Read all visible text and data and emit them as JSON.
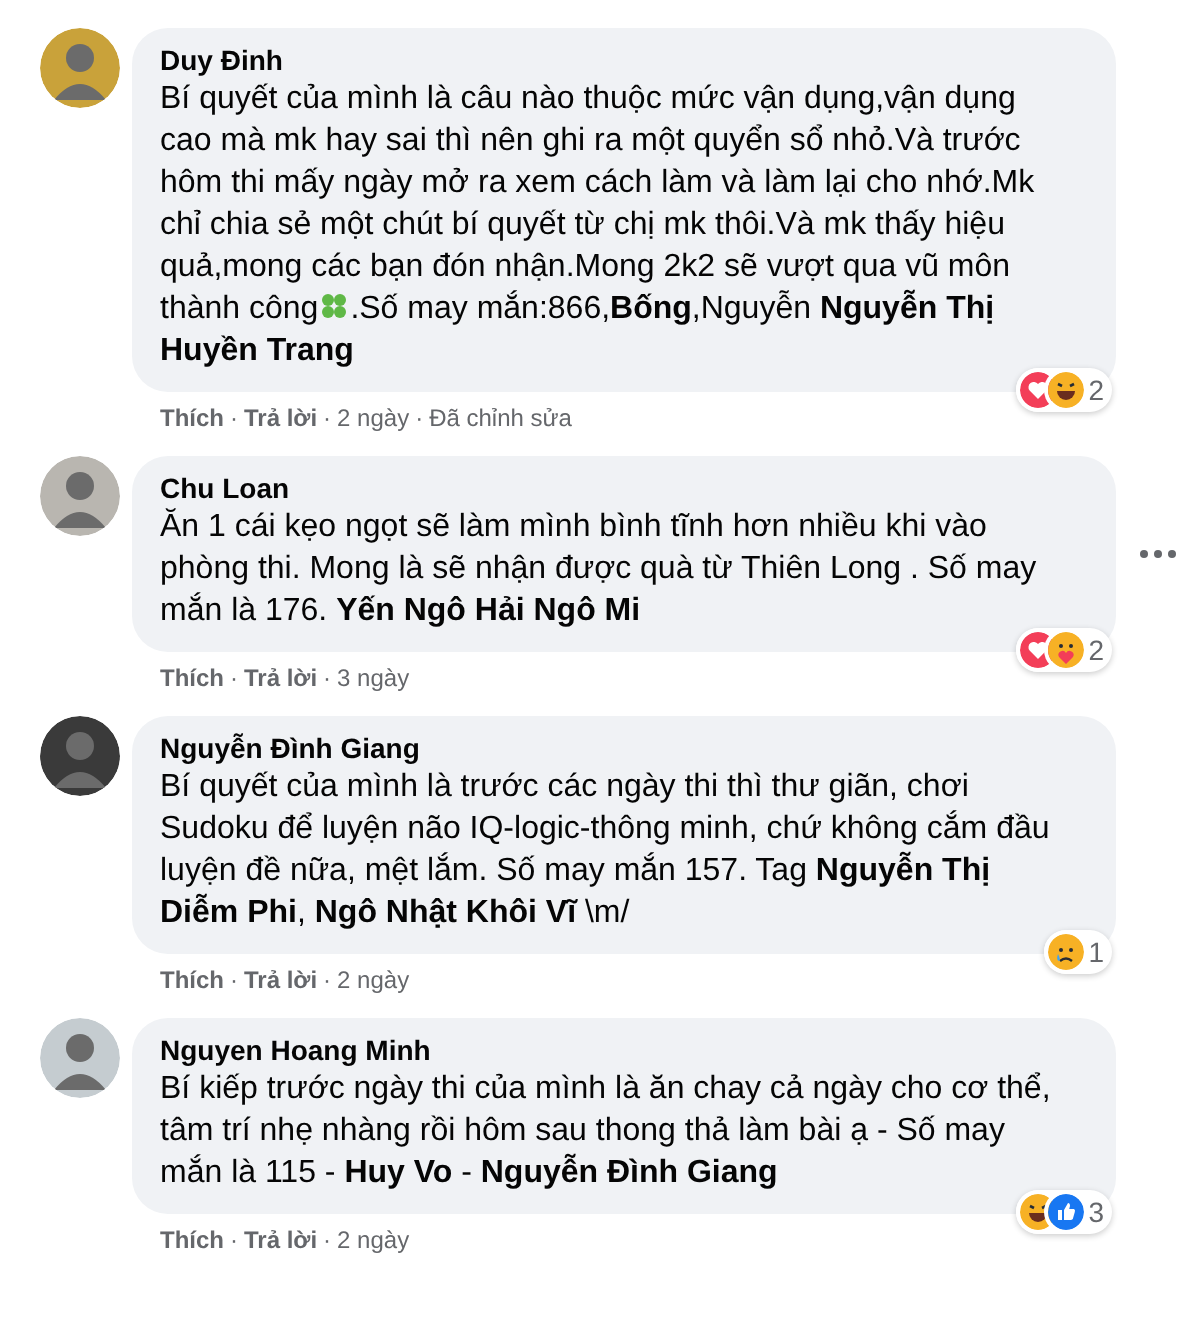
{
  "comments": [
    {
      "author": "Duy Đinh",
      "segments": [
        {
          "kind": "text",
          "text": "Bí quyết của mình là câu nào thuộc mức vận dụng,vận dụng cao mà mk hay sai thì nên ghi ra một quyển sổ nhỏ.Và trước hôm thi mấy ngày mở ra xem cách làm và làm lại cho nhớ.Mk chỉ chia sẻ một chút bí quyết từ chị mk thôi.Và mk thấy hiệu quả,mong các bạn đón nhận.Mong 2k2 sẽ vượt qua vũ môn thành công"
        },
        {
          "kind": "clover"
        },
        {
          "kind": "text",
          "text": ".Số may mắn:866,**Bống**,Nguyễn **Nguyễn Thị Huyền Trang**"
        }
      ],
      "actions": [
        "Thích",
        "Trả lời"
      ],
      "separator": "·",
      "time": "2 ngày",
      "edited": "Đã chỉnh sửa",
      "reactions": [
        {
          "kind": "love"
        },
        {
          "kind": "haha"
        }
      ],
      "count": "2",
      "more": false
    },
    {
      "author": "Chu Loan",
      "segments": [
        {
          "kind": "text",
          "text": "Ăn 1 cái kẹo ngọt sẽ làm mình bình tĩnh hơn nhiều khi vào phòng thi. Mong là sẽ nhận được quà từ Thiên Long . Số may mắn là 176. **Yến Ngô Hải Ngô Mi**"
        }
      ],
      "actions": [
        "Thích",
        "Trả lời"
      ],
      "separator": "·",
      "time": "3 ngày",
      "reactions": [
        {
          "kind": "love"
        },
        {
          "kind": "care"
        }
      ],
      "count": "2",
      "more": true
    },
    {
      "author": "Nguyễn Đình Giang",
      "segments": [
        {
          "kind": "text",
          "text": "Bí quyết của mình là trước các ngày thi thì thư giãn, chơi Sudoku để luyện não IQ-logic-thông minh, chứ không cắm đầu luyện đề nữa, mệt lắm. Số may mắn 157. Tag **Nguyễn Thị Diễm Phi**, **Ngô Nhật Khôi Vĩ** \\m/"
        }
      ],
      "actions": [
        "Thích",
        "Trả lời"
      ],
      "separator": "·",
      "time": "2 ngày",
      "reactions": [
        {
          "kind": "sad"
        }
      ],
      "count": "1",
      "more": false
    },
    {
      "author": "Nguyen Hoang Minh",
      "segments": [
        {
          "kind": "text",
          "text": "Bí kiếp trước ngày thi của mình là ăn chay cả ngày cho cơ thể, tâm trí nhẹ nhàng rồi hôm sau thong thả làm bài ạ - Số may mắn là 115 - **Huy Vo** - **Nguyễn Đình Giang**"
        }
      ],
      "actions": [
        "Thích",
        "Trả lời"
      ],
      "separator": "·",
      "time": "2 ngày",
      "reactions": [
        {
          "kind": "haha"
        },
        {
          "kind": "like"
        }
      ],
      "count": "3",
      "more": false
    }
  ]
}
